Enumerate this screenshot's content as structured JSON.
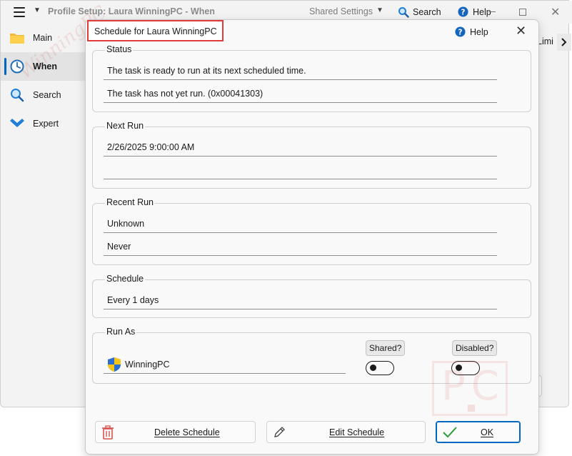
{
  "titlebar": {
    "title": "Profile Setup: Laura WinningPC - When",
    "shared_settings": "Shared Settings",
    "search": "Search",
    "help": "Help"
  },
  "sidebar": {
    "items": [
      {
        "label": "Main",
        "icon": "folder-icon"
      },
      {
        "label": "When",
        "icon": "clock-icon"
      },
      {
        "label": "Search",
        "icon": "search-icon"
      },
      {
        "label": "Expert",
        "icon": "chevron-check-icon"
      }
    ]
  },
  "background": {
    "limit_tab": "Limi"
  },
  "dialog": {
    "title": "Schedule for Laura WinningPC",
    "help": "Help",
    "status": {
      "label": "Status",
      "line1": "The task is ready to run at its next scheduled time.",
      "line2": "The task has not yet run. (0x00041303)"
    },
    "next_run": {
      "label": "Next Run",
      "line1": "2/26/2025 9:00:00 AM",
      "line2": ""
    },
    "recent_run": {
      "label": "Recent Run",
      "line1": "Unknown",
      "line2": "Never"
    },
    "schedule": {
      "label": "Schedule",
      "line1": "Every 1 days"
    },
    "run_as": {
      "label": "Run As",
      "account": "WinningPC",
      "shared_label": "Shared?",
      "disabled_label": "Disabled?",
      "shared": false,
      "disabled": false
    },
    "watermark_logo": "PC",
    "buttons": {
      "delete": "Delete Schedule",
      "edit": "Edit Schedule",
      "ok": "OK"
    }
  },
  "colors": {
    "accent": "#0067c0",
    "highlight_border": "#e03c3c",
    "delete_icon": "#d9534f",
    "ok_check": "#2e9e3e"
  }
}
